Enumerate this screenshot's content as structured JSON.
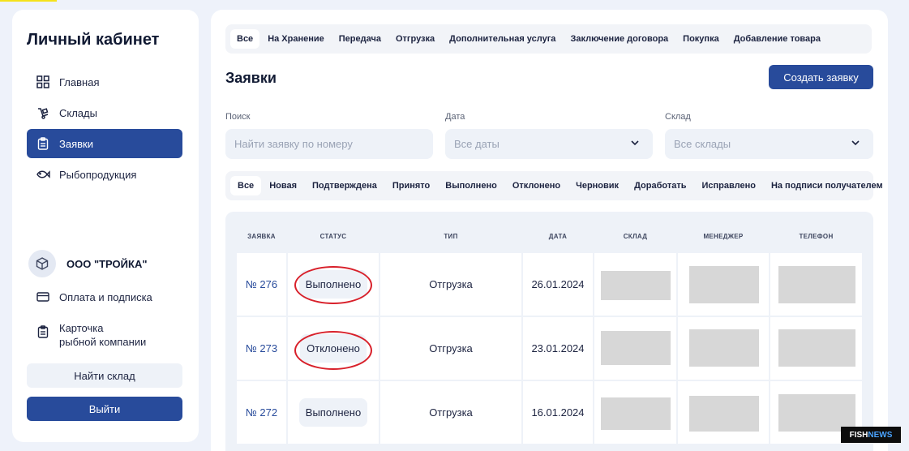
{
  "sidebar": {
    "title": "Личный кабинет",
    "nav": [
      {
        "label": "Главная",
        "icon": "grid-icon"
      },
      {
        "label": "Склады",
        "icon": "dolly-icon"
      },
      {
        "label": "Заявки",
        "icon": "clipboard-icon",
        "active": true
      },
      {
        "label": "Рыбопродукция",
        "icon": "fish-icon"
      }
    ],
    "company_name": "ООО \"ТРОЙКА\"",
    "payment_label": "Оплата и подписка",
    "card_label_1": "Карточка",
    "card_label_2": "рыбной компании",
    "find_button": "Найти склад",
    "logout_button": "Выйти"
  },
  "type_tabs": [
    "Все",
    "На Хранение",
    "Передача",
    "Отгрузка",
    "Дополнительная услуга",
    "Заключение договора",
    "Покупка",
    "Добавление товара"
  ],
  "page_title": "Заявки",
  "create_button": "Создать заявку",
  "filters": {
    "search_label": "Поиск",
    "search_placeholder": "Найти заявку по номеру",
    "date_label": "Дата",
    "date_value": "Все даты",
    "warehouse_label": "Склад",
    "warehouse_value": "Все склады"
  },
  "status_tabs": [
    "Все",
    "Новая",
    "Подтверждена",
    "Принято",
    "Выполнено",
    "Отклонено",
    "Черновик",
    "Доработать",
    "Исправлено",
    "На подписи получателем"
  ],
  "table": {
    "headers": [
      "ЗАЯВКА",
      "СТАТУС",
      "ТИП",
      "ДАТА",
      "СКЛАД",
      "МЕНЕДЖЕР",
      "ТЕЛЕФОН"
    ],
    "rows": [
      {
        "number": "№ 276",
        "status": "Выполнено",
        "type": "Отгрузка",
        "date": "26.01.2024"
      },
      {
        "number": "№ 273",
        "status": "Отклонено",
        "type": "Отгрузка",
        "date": "23.01.2024"
      },
      {
        "number": "№ 272",
        "status": "Выполнено",
        "type": "Отгрузка",
        "date": "16.01.2024"
      }
    ]
  },
  "watermark": {
    "part1": "FISH",
    "part2": "NEWS"
  },
  "colors": {
    "primary": "#284b9b",
    "annotation": "#d8202a",
    "background": "#eef2fa"
  }
}
